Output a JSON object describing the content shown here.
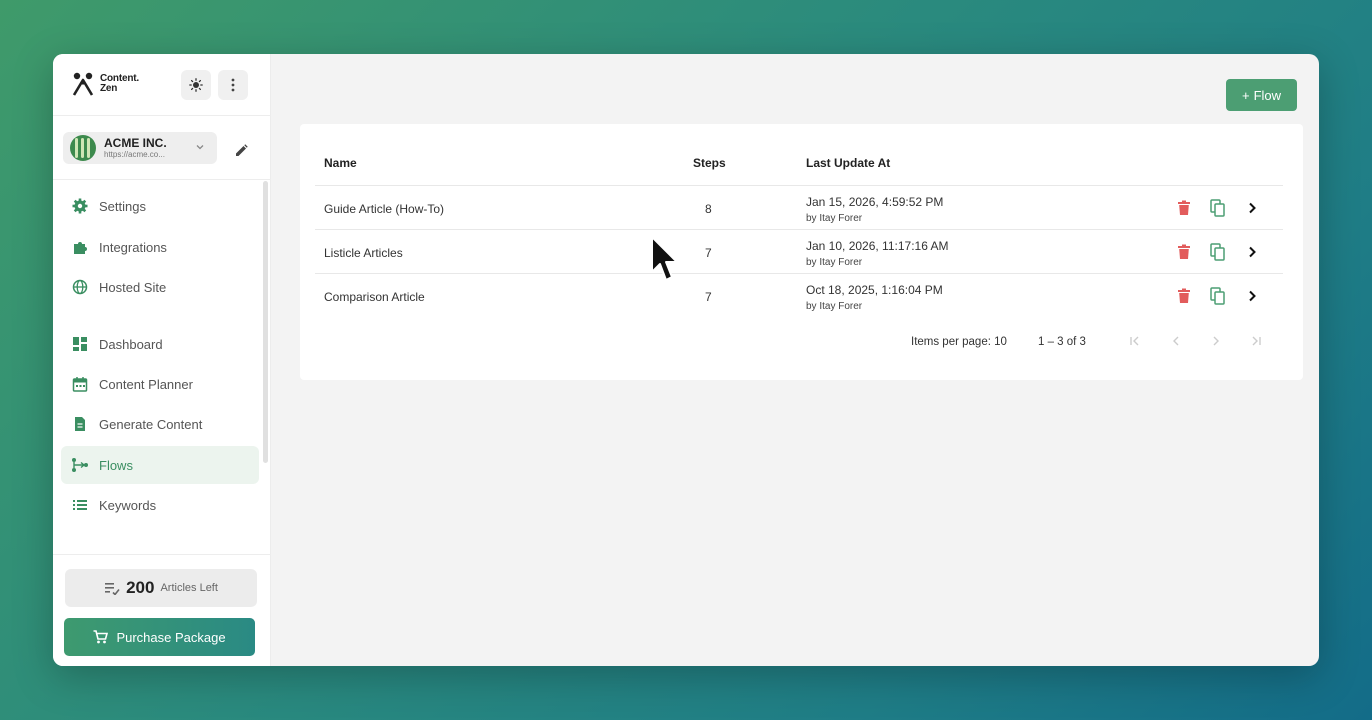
{
  "brand": {
    "line1": "Content.",
    "line2": "Zen"
  },
  "org": {
    "name": "ACME INC.",
    "url": "https://acme.co..."
  },
  "nav": {
    "settings": "Settings",
    "integrations": "Integrations",
    "hosted_site": "Hosted Site",
    "dashboard": "Dashboard",
    "content_planner": "Content Planner",
    "generate_content": "Generate Content",
    "flows": "Flows",
    "keywords": "Keywords"
  },
  "articles": {
    "count": "200",
    "label": "Articles Left"
  },
  "purchase_label": "Purchase Package",
  "add_flow_label": "Flow",
  "table": {
    "headers": {
      "name": "Name",
      "steps": "Steps",
      "updated": "Last Update At"
    },
    "rows": [
      {
        "name": "Guide Article (How-To)",
        "steps": "8",
        "date": "Jan 15, 2026, 4:59:52 PM",
        "by": "by Itay Forer"
      },
      {
        "name": "Listicle Articles",
        "steps": "7",
        "date": "Jan 10, 2026, 11:17:16 AM",
        "by": "by Itay Forer"
      },
      {
        "name": "Comparison Article",
        "steps": "7",
        "date": "Oct 18, 2025, 1:16:04 PM",
        "by": "by Itay Forer"
      }
    ]
  },
  "pagination": {
    "items_per_page": "Items per page: 10",
    "range": "1 – 3 of 3"
  },
  "colors": {
    "accent": "#4c9e73",
    "danger": "#e25c5c",
    "background_gradient_start": "#3f9a6a",
    "background_gradient_end": "#136c88"
  }
}
